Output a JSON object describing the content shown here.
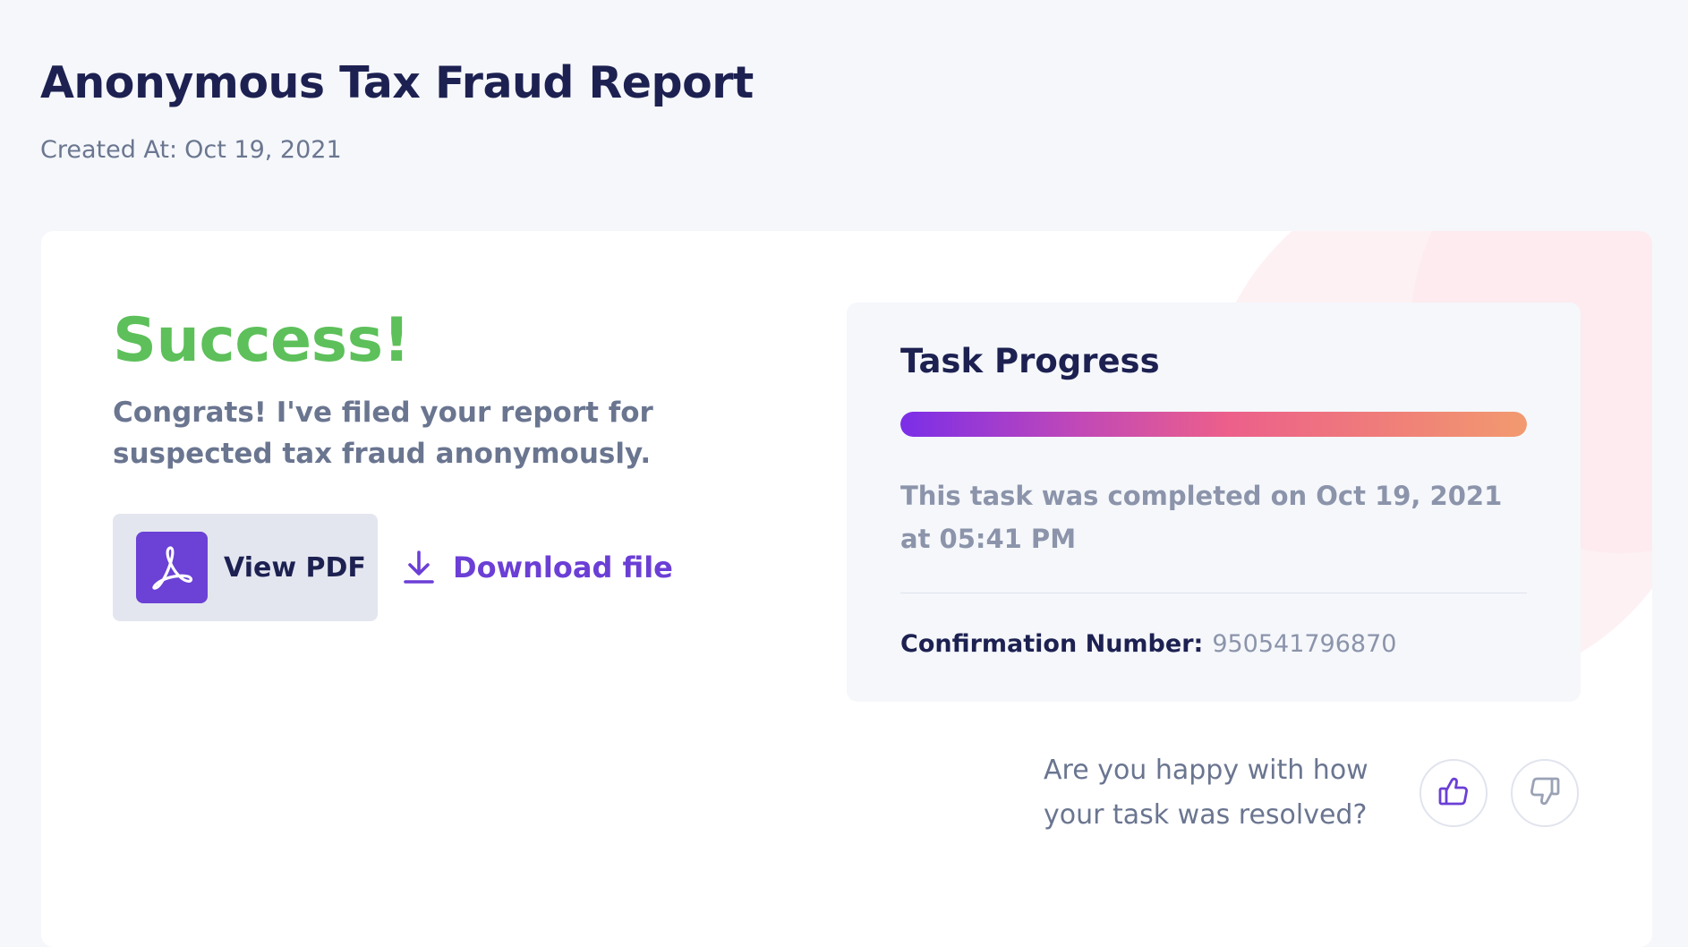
{
  "page": {
    "title": "Anonymous Tax Fraud Report",
    "created_label": "Created At:",
    "created_date": "Oct 19, 2021"
  },
  "result": {
    "heading": "Success!",
    "message": "Congrats! I've filed your report for suspected tax fraud anonymously.",
    "view_pdf_label": "View PDF",
    "download_label": "Download file"
  },
  "progress": {
    "title": "Task Progress",
    "percent": 100,
    "completed_text": "This task was completed on Oct 19, 2021 at 05:41 PM",
    "confirmation_label": "Confirmation Number:",
    "confirmation_value": "950541796870"
  },
  "feedback": {
    "question": "Are you happy with how your task was resolved?"
  },
  "icons": {
    "pdf": "acrobat-pdf-icon",
    "download": "download-icon",
    "thumbs_up": "thumbs-up-icon",
    "thumbs_down": "thumbs-down-icon"
  },
  "colors": {
    "success": "#5dc05a",
    "accent": "#6b3fd6",
    "title": "#1d2151",
    "gradient": [
      "#7b2ee8",
      "#c048b8",
      "#ec5f8b",
      "#f29a6f"
    ]
  }
}
